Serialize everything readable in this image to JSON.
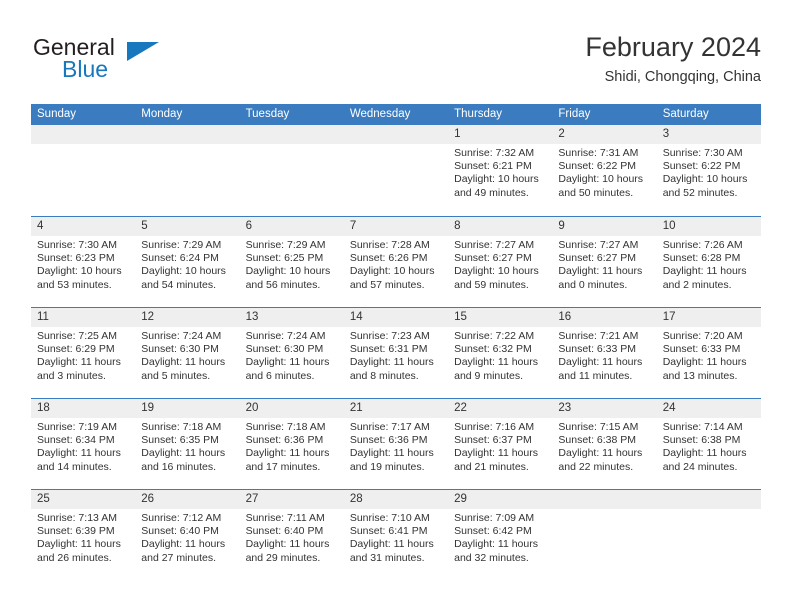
{
  "brand": {
    "name_part1": "General",
    "name_part2": "Blue",
    "accent_color": "#1878be"
  },
  "header": {
    "title": "February 2024",
    "subtitle": "Shidi, Chongqing, China"
  },
  "theme": {
    "header_blue": "#3a7cbf",
    "day_strip_gray": "#efefef",
    "text_color": "#333333"
  },
  "weekday_headers": [
    "Sunday",
    "Monday",
    "Tuesday",
    "Wednesday",
    "Thursday",
    "Friday",
    "Saturday"
  ],
  "weeks": [
    [
      {
        "day": "",
        "sunrise": "",
        "sunset": "",
        "daylight_line1": "",
        "daylight_line2": "",
        "empty": true
      },
      {
        "day": "",
        "sunrise": "",
        "sunset": "",
        "daylight_line1": "",
        "daylight_line2": "",
        "empty": true
      },
      {
        "day": "",
        "sunrise": "",
        "sunset": "",
        "daylight_line1": "",
        "daylight_line2": "",
        "empty": true
      },
      {
        "day": "",
        "sunrise": "",
        "sunset": "",
        "daylight_line1": "",
        "daylight_line2": "",
        "empty": true
      },
      {
        "day": "1",
        "sunrise": "Sunrise: 7:32 AM",
        "sunset": "Sunset: 6:21 PM",
        "daylight_line1": "Daylight: 10 hours",
        "daylight_line2": "and 49 minutes."
      },
      {
        "day": "2",
        "sunrise": "Sunrise: 7:31 AM",
        "sunset": "Sunset: 6:22 PM",
        "daylight_line1": "Daylight: 10 hours",
        "daylight_line2": "and 50 minutes."
      },
      {
        "day": "3",
        "sunrise": "Sunrise: 7:30 AM",
        "sunset": "Sunset: 6:22 PM",
        "daylight_line1": "Daylight: 10 hours",
        "daylight_line2": "and 52 minutes."
      }
    ],
    [
      {
        "day": "4",
        "sunrise": "Sunrise: 7:30 AM",
        "sunset": "Sunset: 6:23 PM",
        "daylight_line1": "Daylight: 10 hours",
        "daylight_line2": "and 53 minutes."
      },
      {
        "day": "5",
        "sunrise": "Sunrise: 7:29 AM",
        "sunset": "Sunset: 6:24 PM",
        "daylight_line1": "Daylight: 10 hours",
        "daylight_line2": "and 54 minutes."
      },
      {
        "day": "6",
        "sunrise": "Sunrise: 7:29 AM",
        "sunset": "Sunset: 6:25 PM",
        "daylight_line1": "Daylight: 10 hours",
        "daylight_line2": "and 56 minutes."
      },
      {
        "day": "7",
        "sunrise": "Sunrise: 7:28 AM",
        "sunset": "Sunset: 6:26 PM",
        "daylight_line1": "Daylight: 10 hours",
        "daylight_line2": "and 57 minutes."
      },
      {
        "day": "8",
        "sunrise": "Sunrise: 7:27 AM",
        "sunset": "Sunset: 6:27 PM",
        "daylight_line1": "Daylight: 10 hours",
        "daylight_line2": "and 59 minutes."
      },
      {
        "day": "9",
        "sunrise": "Sunrise: 7:27 AM",
        "sunset": "Sunset: 6:27 PM",
        "daylight_line1": "Daylight: 11 hours",
        "daylight_line2": "and 0 minutes."
      },
      {
        "day": "10",
        "sunrise": "Sunrise: 7:26 AM",
        "sunset": "Sunset: 6:28 PM",
        "daylight_line1": "Daylight: 11 hours",
        "daylight_line2": "and 2 minutes."
      }
    ],
    [
      {
        "day": "11",
        "sunrise": "Sunrise: 7:25 AM",
        "sunset": "Sunset: 6:29 PM",
        "daylight_line1": "Daylight: 11 hours",
        "daylight_line2": "and 3 minutes."
      },
      {
        "day": "12",
        "sunrise": "Sunrise: 7:24 AM",
        "sunset": "Sunset: 6:30 PM",
        "daylight_line1": "Daylight: 11 hours",
        "daylight_line2": "and 5 minutes."
      },
      {
        "day": "13",
        "sunrise": "Sunrise: 7:24 AM",
        "sunset": "Sunset: 6:30 PM",
        "daylight_line1": "Daylight: 11 hours",
        "daylight_line2": "and 6 minutes."
      },
      {
        "day": "14",
        "sunrise": "Sunrise: 7:23 AM",
        "sunset": "Sunset: 6:31 PM",
        "daylight_line1": "Daylight: 11 hours",
        "daylight_line2": "and 8 minutes."
      },
      {
        "day": "15",
        "sunrise": "Sunrise: 7:22 AM",
        "sunset": "Sunset: 6:32 PM",
        "daylight_line1": "Daylight: 11 hours",
        "daylight_line2": "and 9 minutes."
      },
      {
        "day": "16",
        "sunrise": "Sunrise: 7:21 AM",
        "sunset": "Sunset: 6:33 PM",
        "daylight_line1": "Daylight: 11 hours",
        "daylight_line2": "and 11 minutes."
      },
      {
        "day": "17",
        "sunrise": "Sunrise: 7:20 AM",
        "sunset": "Sunset: 6:33 PM",
        "daylight_line1": "Daylight: 11 hours",
        "daylight_line2": "and 13 minutes."
      }
    ],
    [
      {
        "day": "18",
        "sunrise": "Sunrise: 7:19 AM",
        "sunset": "Sunset: 6:34 PM",
        "daylight_line1": "Daylight: 11 hours",
        "daylight_line2": "and 14 minutes."
      },
      {
        "day": "19",
        "sunrise": "Sunrise: 7:18 AM",
        "sunset": "Sunset: 6:35 PM",
        "daylight_line1": "Daylight: 11 hours",
        "daylight_line2": "and 16 minutes."
      },
      {
        "day": "20",
        "sunrise": "Sunrise: 7:18 AM",
        "sunset": "Sunset: 6:36 PM",
        "daylight_line1": "Daylight: 11 hours",
        "daylight_line2": "and 17 minutes."
      },
      {
        "day": "21",
        "sunrise": "Sunrise: 7:17 AM",
        "sunset": "Sunset: 6:36 PM",
        "daylight_line1": "Daylight: 11 hours",
        "daylight_line2": "and 19 minutes."
      },
      {
        "day": "22",
        "sunrise": "Sunrise: 7:16 AM",
        "sunset": "Sunset: 6:37 PM",
        "daylight_line1": "Daylight: 11 hours",
        "daylight_line2": "and 21 minutes."
      },
      {
        "day": "23",
        "sunrise": "Sunrise: 7:15 AM",
        "sunset": "Sunset: 6:38 PM",
        "daylight_line1": "Daylight: 11 hours",
        "daylight_line2": "and 22 minutes."
      },
      {
        "day": "24",
        "sunrise": "Sunrise: 7:14 AM",
        "sunset": "Sunset: 6:38 PM",
        "daylight_line1": "Daylight: 11 hours",
        "daylight_line2": "and 24 minutes."
      }
    ],
    [
      {
        "day": "25",
        "sunrise": "Sunrise: 7:13 AM",
        "sunset": "Sunset: 6:39 PM",
        "daylight_line1": "Daylight: 11 hours",
        "daylight_line2": "and 26 minutes."
      },
      {
        "day": "26",
        "sunrise": "Sunrise: 7:12 AM",
        "sunset": "Sunset: 6:40 PM",
        "daylight_line1": "Daylight: 11 hours",
        "daylight_line2": "and 27 minutes."
      },
      {
        "day": "27",
        "sunrise": "Sunrise: 7:11 AM",
        "sunset": "Sunset: 6:40 PM",
        "daylight_line1": "Daylight: 11 hours",
        "daylight_line2": "and 29 minutes."
      },
      {
        "day": "28",
        "sunrise": "Sunrise: 7:10 AM",
        "sunset": "Sunset: 6:41 PM",
        "daylight_line1": "Daylight: 11 hours",
        "daylight_line2": "and 31 minutes."
      },
      {
        "day": "29",
        "sunrise": "Sunrise: 7:09 AM",
        "sunset": "Sunset: 6:42 PM",
        "daylight_line1": "Daylight: 11 hours",
        "daylight_line2": "and 32 minutes."
      },
      {
        "day": "",
        "sunrise": "",
        "sunset": "",
        "daylight_line1": "",
        "daylight_line2": "",
        "empty": true
      },
      {
        "day": "",
        "sunrise": "",
        "sunset": "",
        "daylight_line1": "",
        "daylight_line2": "",
        "empty": true
      }
    ]
  ]
}
